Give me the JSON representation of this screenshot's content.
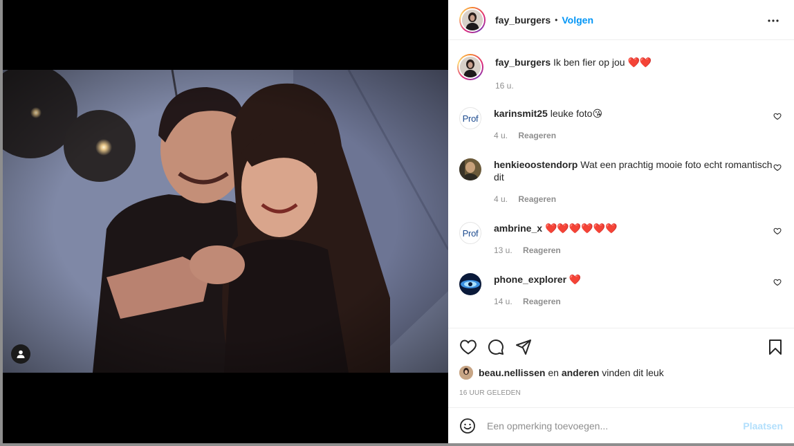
{
  "post": {
    "username": "fay_burgers",
    "separator": "•",
    "follow_label": "Volgen",
    "more_icon": "more-horizontal-icon"
  },
  "caption": {
    "username": "fay_burgers",
    "text": "Ik ben fier op jou",
    "emoji": "❤️❤️",
    "age": "16 u."
  },
  "comments": [
    {
      "username": "karinsmit25",
      "text": "leuke foto",
      "emoji": "😘",
      "age": "4 u.",
      "reply": "Reageren",
      "avatar_text": "Prof"
    },
    {
      "username": "henkieoostendorp",
      "text": "Wat een prachtig mooie foto echt romantisch dit",
      "emoji": "",
      "age": "4 u.",
      "reply": "Reageren"
    },
    {
      "username": "ambrine_x",
      "text": "",
      "emoji": "❤️❤️❤️❤️❤️❤️",
      "age": "13 u.",
      "reply": "Reageren",
      "avatar_text": "Prof"
    },
    {
      "username": "phone_explorer",
      "text": "",
      "emoji": "❤️",
      "age": "14 u.",
      "reply": "Reageren"
    }
  ],
  "likes": {
    "first_user": "beau.nellissen",
    "connector": "en",
    "others": "anderen",
    "suffix": "vinden dit leuk"
  },
  "timestamp": "16 UUR GELEDEN",
  "comment_box": {
    "placeholder": "Een opmerking toevoegen...",
    "post_label": "Plaatsen"
  },
  "colors": {
    "accent": "#0095f6",
    "post_disabled": "#b2dffc",
    "muted": "#8e8e8e",
    "heart": "#e0191f"
  }
}
